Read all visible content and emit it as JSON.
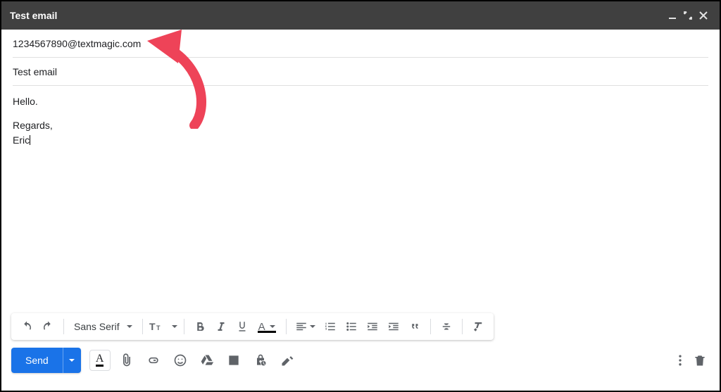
{
  "titlebar": {
    "title": "Test email"
  },
  "fields": {
    "to": "1234567890@textmagic.com",
    "subject": "Test email"
  },
  "body": {
    "line1": "Hello.",
    "sig1": "Regards,",
    "sig2": "Eric"
  },
  "toolbar": {
    "font": "Sans Serif"
  },
  "send": {
    "label": "Send"
  }
}
